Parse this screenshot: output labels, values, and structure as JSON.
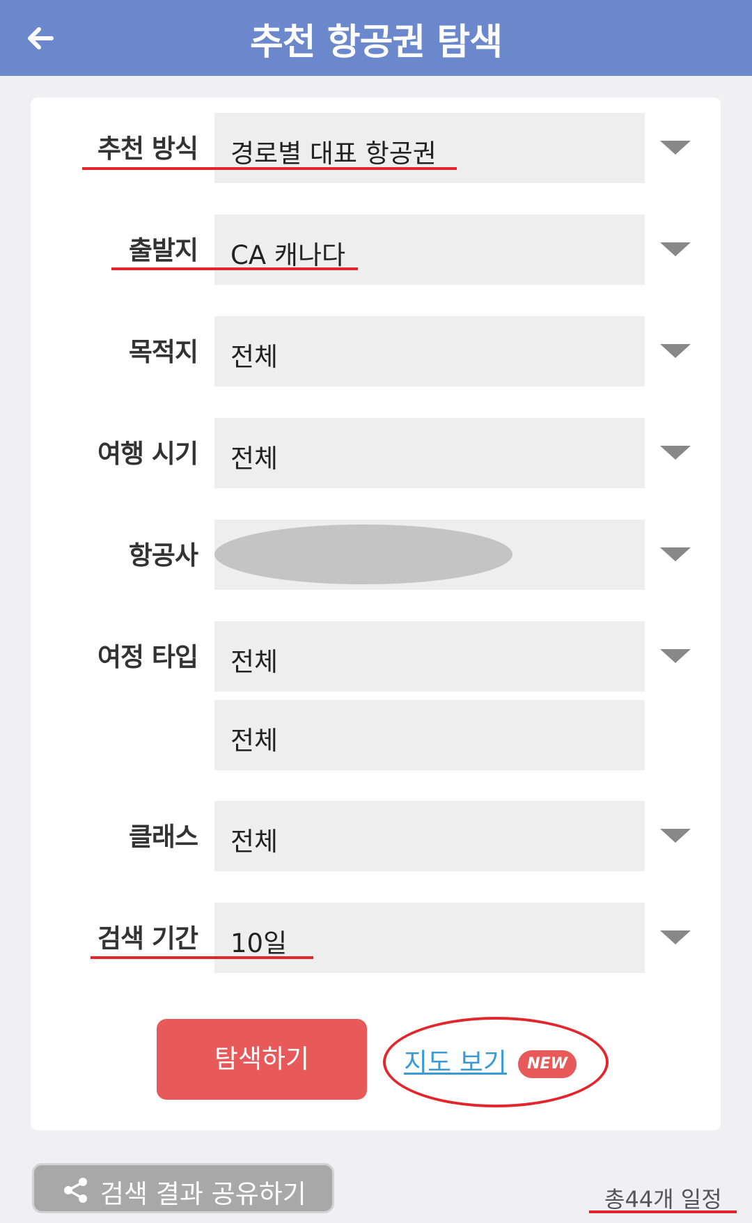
{
  "header": {
    "title": "추천 항공권 탐색",
    "back_icon": "arrow-left-icon"
  },
  "form": {
    "recommend_method": {
      "label": "추천 방식",
      "value": "경로별 대표 항공권"
    },
    "departure": {
      "label": "출발지",
      "value": "CA 캐나다"
    },
    "destination": {
      "label": "목적지",
      "value": "전체"
    },
    "travel_period": {
      "label": "여행 시기",
      "value": "전체"
    },
    "airline": {
      "label": "항공사",
      "value": ""
    },
    "trip_type": {
      "label": "여정 타입",
      "value": "전체",
      "value2": "전체"
    },
    "class": {
      "label": "클래스",
      "value": "전체"
    },
    "search_period": {
      "label": "검색 기간",
      "value": "10일"
    }
  },
  "actions": {
    "search_label": "탐색하기",
    "map_label": "지도 보기",
    "new_badge": "NEW"
  },
  "footer": {
    "share_label": "검색 결과 공유하기",
    "total_label": "총44개 일정"
  },
  "colors": {
    "header": "#6b88cc",
    "primary": "#e85a5a",
    "annotation": "#e2262c",
    "link": "#3a9ad8"
  }
}
